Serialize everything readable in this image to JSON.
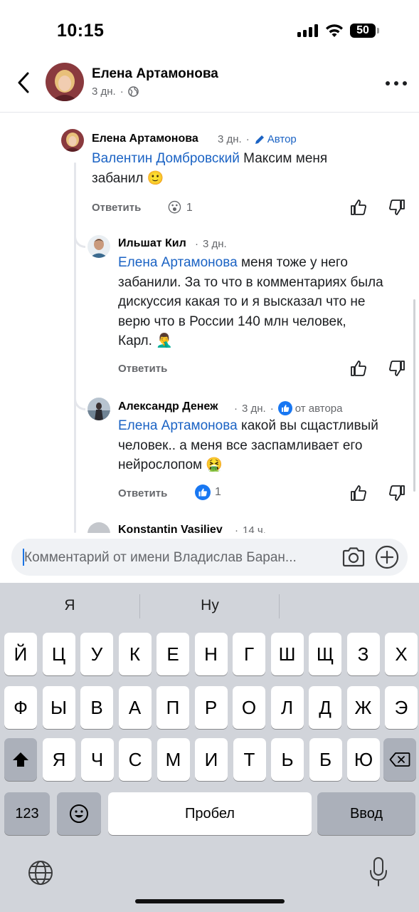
{
  "status_bar": {
    "time": "10:15",
    "battery": "50"
  },
  "header": {
    "name": "Елена Артамонова",
    "time": "3 дн.",
    "separator": "·"
  },
  "comments": [
    {
      "author": "Елена Артамонова",
      "time": "3 дн.",
      "badge": "Автор",
      "mention": "Валентин Домбровский",
      "text_line1": " Максим меня",
      "text_line2": "забанил 🙂",
      "reply_label": "Ответить",
      "reaction_emoji": "😮",
      "reaction_count": "1"
    },
    {
      "author": "Ильшат Кил",
      "time": "3 дн.",
      "mention": "Елена Артамонова",
      "text_line1": " меня тоже у него",
      "text_line2": "забанили. За то что в комментариях была",
      "text_line3": "дискуссия какая то и я высказал что не",
      "text_line4": "верю что в России 140 млн человек,",
      "text_line5": "Карл. 🤦‍♂️",
      "reply_label": "Ответить"
    },
    {
      "author": "Александр Денеж",
      "time": "3 дн.",
      "badge": "от автора",
      "mention": "Елена Артамонова",
      "text_line1": " какой вы сщастливый",
      "text_line2": "человек.. а меня все заспамливает его",
      "text_line3": "нейрослопом 🤮",
      "reply_label": "Ответить",
      "reaction_count": "1"
    },
    {
      "author": "Konstantin Vasiliev",
      "time": "14 ч."
    }
  ],
  "comment_input": {
    "placeholder": "Комментарий от имени Владислав Баран..."
  },
  "keyboard": {
    "suggestions": [
      "Я",
      "Ну"
    ],
    "row1": [
      "Й",
      "Ц",
      "У",
      "К",
      "Е",
      "Н",
      "Г",
      "Ш",
      "Щ",
      "З",
      "Х"
    ],
    "row2": [
      "Ф",
      "Ы",
      "В",
      "А",
      "П",
      "Р",
      "О",
      "Л",
      "Д",
      "Ж",
      "Э"
    ],
    "row3": [
      "Я",
      "Ч",
      "С",
      "М",
      "И",
      "Т",
      "Ь",
      "Б",
      "Ю"
    ],
    "numbers_key": "123",
    "space_key": "Пробел",
    "return_key": "Ввод"
  },
  "colors": {
    "accent": "#1b63c4",
    "like_blue": "#1877f2",
    "keyboard_bg": "#d1d4da"
  }
}
